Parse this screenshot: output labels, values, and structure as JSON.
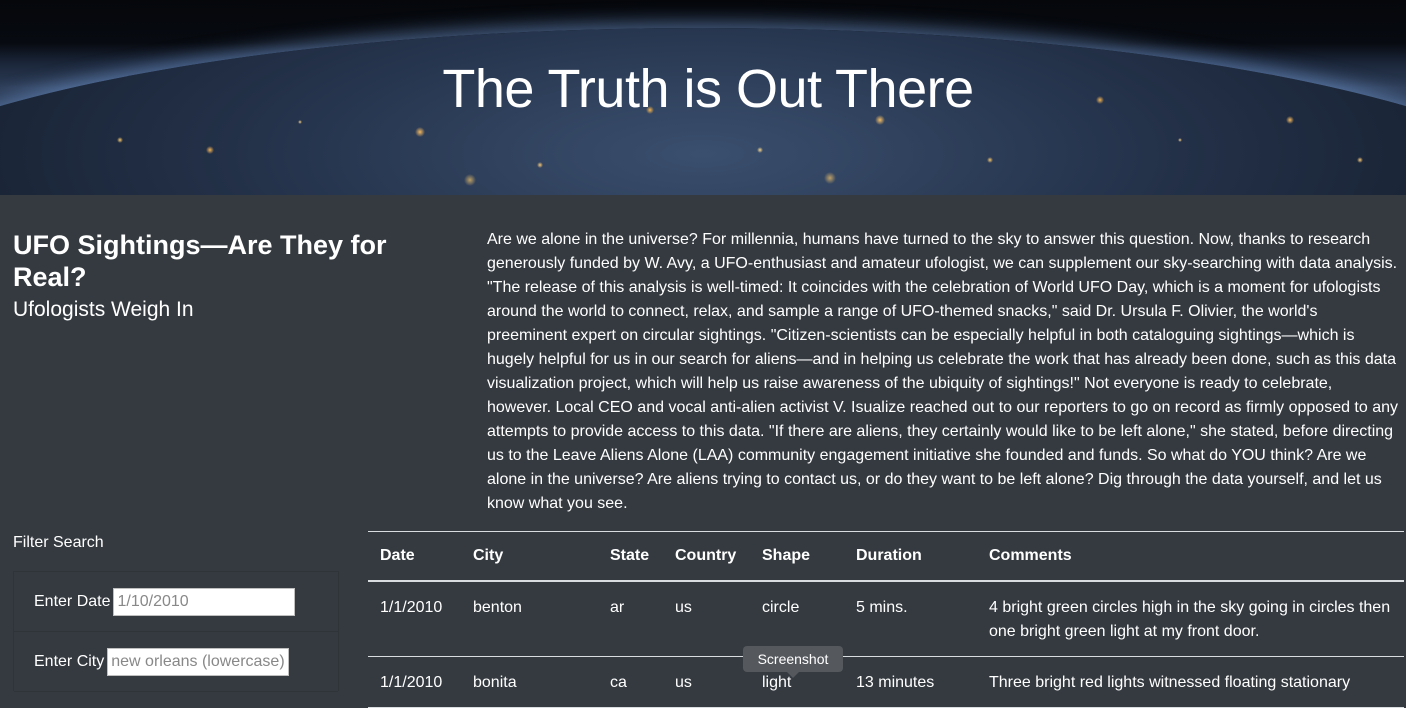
{
  "hero": {
    "title": "The Truth is Out There"
  },
  "headline": {
    "title": "UFO Sightings—Are They for Real?",
    "subtitle": "Ufologists Weigh In"
  },
  "article": {
    "body": "Are we alone in the universe? For millennia, humans have turned to the sky to answer this question. Now, thanks to research generously funded by W. Avy, a UFO-enthusiast and amateur ufologist, we can supplement our sky-searching with data analysis. \"The release of this analysis is well-timed: It coincides with the celebration of World UFO Day, which is a moment for ufologists around the world to connect, relax, and sample a range of UFO-themed snacks,\" said Dr. Ursula F. Olivier, the world's preeminent expert on circular sightings. \"Citizen-scientists can be especially helpful in both cataloguing sightings—which is hugely helpful for us in our search for aliens—and in helping us celebrate the work that has already been done, such as this data visualization project, which will help us raise awareness of the ubiquity of sightings!\" Not everyone is ready to celebrate, however. Local CEO and vocal anti-alien activist V. Isualize reached out to our reporters to go on record as firmly opposed to any attempts to provide access to this data. \"If there are aliens, they certainly would like to be left alone,\" she stated, before directing us to the Leave Aliens Alone (LAA) community engagement initiative she founded and funds. So what do YOU think? Are we alone in the universe? Are aliens trying to contact us, or do they want to be left alone? Dig through the data yourself, and let us know what you see."
  },
  "filter": {
    "title": "Filter Search",
    "date_label": "Enter Date",
    "date_placeholder": "1/10/2010",
    "city_label": "Enter City",
    "city_placeholder": "new orleans (lowercase)"
  },
  "table": {
    "headers": [
      "Date",
      "City",
      "State",
      "Country",
      "Shape",
      "Duration",
      "Comments"
    ],
    "rows": [
      [
        "1/1/2010",
        "benton",
        "ar",
        "us",
        "circle",
        "5 mins.",
        "4 bright green circles high in the sky going in circles then one bright green light at my front door."
      ],
      [
        "1/1/2010",
        "bonita",
        "ca",
        "us",
        "light",
        "13 minutes",
        "Three bright red lights witnessed floating stationary"
      ]
    ]
  },
  "tooltip": {
    "label": "Screenshot"
  }
}
